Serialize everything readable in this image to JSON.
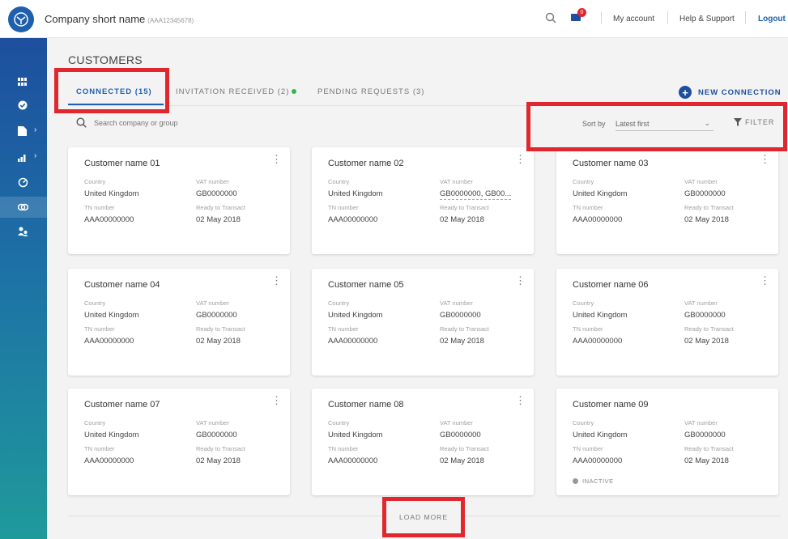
{
  "header": {
    "company_name": "Company short name",
    "company_code": "(AAA12345678)",
    "notification_count": "0",
    "links": [
      "My account",
      "Help & Support",
      "Logout"
    ]
  },
  "page_title": "CUSTOMERS",
  "tabs": [
    {
      "label": "CONNECTED (15)",
      "active": true
    },
    {
      "label": "INVITATION RECEIVED (2)",
      "active": false,
      "indicator_color": "#3bb54a"
    },
    {
      "label": "PENDING REQUESTS (3)",
      "active": false
    }
  ],
  "new_connection_label": "NEW CONNECTION",
  "search": {
    "placeholder": "Search company or group"
  },
  "sort": {
    "label": "Sort by",
    "value": "Latest first"
  },
  "filter_label": "FILTER",
  "field_labels": {
    "country": "Country",
    "vat": "VAT number",
    "tin": "TN number",
    "ready": "Ready to Transact"
  },
  "customers": [
    {
      "name": "Customer name 01",
      "country": "United Kingdom",
      "vat": "GB0000000",
      "tin": "AAA00000000",
      "ready": "02 May 2018"
    },
    {
      "name": "Customer name 02",
      "country": "United Kingdom",
      "vat": "GB0000000, GB00...",
      "tin": "AAA00000000",
      "ready": "02 May 2018"
    },
    {
      "name": "Customer name 03",
      "country": "United Kingdom",
      "vat": "GB0000000",
      "tin": "AAA00000000",
      "ready": "02 May 2018"
    },
    {
      "name": "Customer name 04",
      "country": "United Kingdom",
      "vat": "GB0000000",
      "tin": "AAA00000000",
      "ready": "02 May 2018"
    },
    {
      "name": "Customer name 05",
      "country": "United Kingdom",
      "vat": "GB0000000",
      "tin": "AAA00000000",
      "ready": "02 May 2018"
    },
    {
      "name": "Customer name 06",
      "country": "United Kingdom",
      "vat": "GB0000000",
      "tin": "AAA00000000",
      "ready": "02 May 2018"
    },
    {
      "name": "Customer name 07",
      "country": "United Kingdom",
      "vat": "GB0000000",
      "tin": "AAA00000000",
      "ready": "02 May 2018"
    },
    {
      "name": "Customer name 08",
      "country": "United Kingdom",
      "vat": "GB0000000",
      "tin": "AAA00000000",
      "ready": "02 May 2018"
    },
    {
      "name": "Customer name 09",
      "country": "United Kingdom",
      "vat": "GB0000000",
      "tin": "AAA00000000",
      "ready": "02 May 2018",
      "status": "INACTIVE"
    }
  ],
  "load_more_label": "LOAD MORE",
  "sidebar": {
    "items": [
      {
        "icon": "dashboard-icon"
      },
      {
        "icon": "check-circle-icon"
      },
      {
        "icon": "document-icon",
        "has_submenu": true
      },
      {
        "icon": "chart-icon",
        "has_submenu": true
      },
      {
        "icon": "gauge-icon"
      },
      {
        "icon": "connections-icon",
        "active": true
      },
      {
        "icon": "users-icon"
      }
    ]
  },
  "colors": {
    "primary": "#1e5fae",
    "highlight": "#e1262d",
    "status_active_dot": "#3bb54a"
  }
}
